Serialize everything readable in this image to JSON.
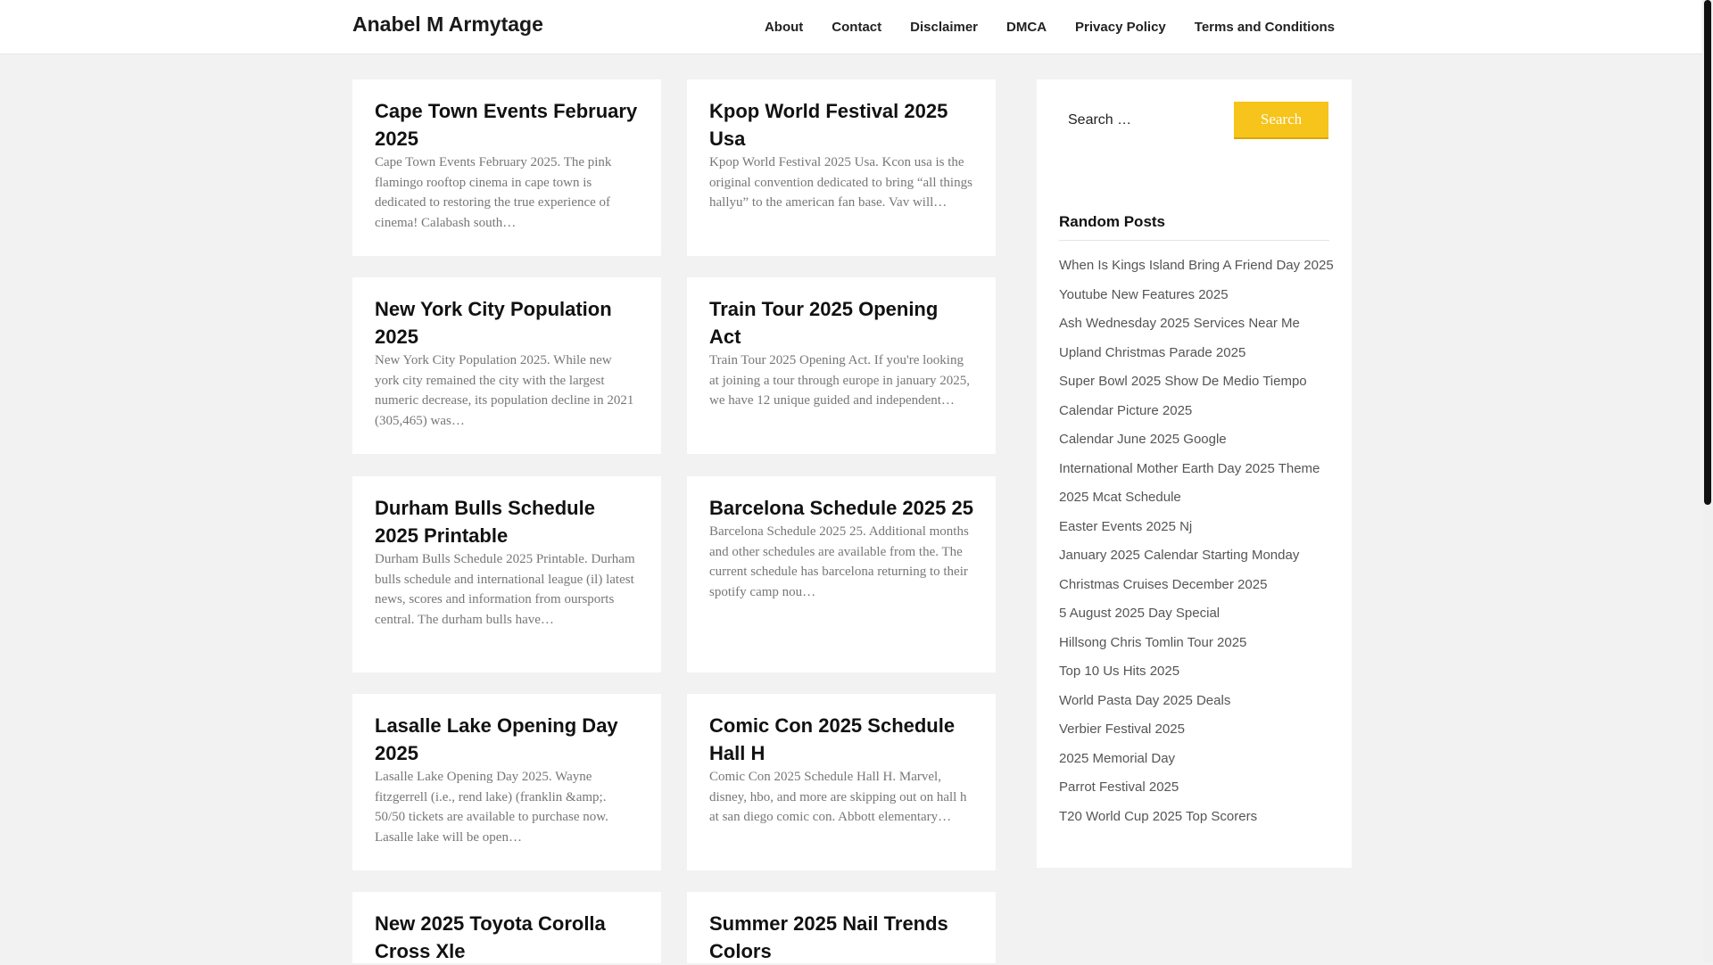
{
  "header": {
    "site_title": "Anabel M Armytage",
    "nav": [
      "About",
      "Contact",
      "Disclaimer",
      "DMCA",
      "Privacy Policy",
      "Terms and Conditions"
    ]
  },
  "posts": [
    {
      "title": "Cape Town Events February 2025",
      "excerpt": "Cape Town Events February 2025. The pink flamingo rooftop cinema in cape town is dedicated to restoring the true experience of cinema! Calabash south…"
    },
    {
      "title": "Kpop World Festival 2025 Usa",
      "excerpt": "Kpop World Festival 2025 Usa. Kcon usa is the original convention dedicated to bring “all things hallyu” to the american fan base. Vav will…"
    },
    {
      "title": "New York City Population 2025",
      "excerpt": "New York City Population 2025. While new york city remained the city with the largest numeric decrease, its population decline in 2021 (305,465) was…"
    },
    {
      "title": "Train Tour 2025 Opening Act",
      "excerpt": "Train Tour 2025 Opening Act. If you're looking at joining a tour through europe in january 2025, we have 12 unique guided and independent…"
    },
    {
      "title": "Durham Bulls Schedule 2025 Printable",
      "excerpt": "Durham Bulls Schedule 2025 Printable. Durham bulls schedule and international league (il) latest news, scores and information from oursports central. The durham bulls have…"
    },
    {
      "title": "Barcelona Schedule 2025 25",
      "excerpt": "Barcelona Schedule 2025 25. Additional months and other schedules are available from the. The current schedule has barcelona returning to their spotify camp nou…"
    },
    {
      "title": "Lasalle Lake Opening Day 2025",
      "excerpt": "Lasalle Lake Opening Day 2025. Wayne fitzgerrell (i.e., rend lake) (franklin &amp;. 50/50 tickets are available to purchase now. Lasalle lake will be open…"
    },
    {
      "title": "Comic Con 2025 Schedule Hall H",
      "excerpt": "Comic Con 2025 Schedule Hall H. Marvel, disney, hbo, and more are skipping out on hall h at san diego comic con. Abbott elementary…"
    },
    {
      "title": "New 2025 Toyota Corolla Cross Xle",
      "excerpt": ""
    },
    {
      "title": "Summer 2025 Nail Trends Colors",
      "excerpt": ""
    }
  ],
  "sidebar": {
    "search_placeholder": "Search …",
    "search_button": "Search",
    "random_title": "Random Posts",
    "random_posts": [
      "When Is Kings Island Bring A Friend Day 2025",
      "Youtube New Features 2025",
      "Ash Wednesday 2025 Services Near Me",
      "Upland Christmas Parade 2025",
      "Super Bowl 2025 Show De Medio Tiempo",
      "Calendar Picture 2025",
      "Calendar June 2025 Google",
      "International Mother Earth Day 2025 Theme",
      "2025 Mcat Schedule",
      "Easter Events 2025 Nj",
      "January 2025 Calendar Starting Monday",
      "Christmas Cruises December 2025",
      "5 August 2025 Day Special",
      "Hillsong Chris Tomlin Tour 2025",
      "Top 10 Us Hits 2025",
      "World Pasta Day 2025 Deals",
      "Verbier Festival 2025",
      "2025 Memorial Day",
      "Parrot Festival 2025",
      "T20 World Cup 2025 Top Scorers"
    ]
  },
  "colors": {
    "accent": "#f6c41a",
    "background": "#f2f2f2"
  }
}
